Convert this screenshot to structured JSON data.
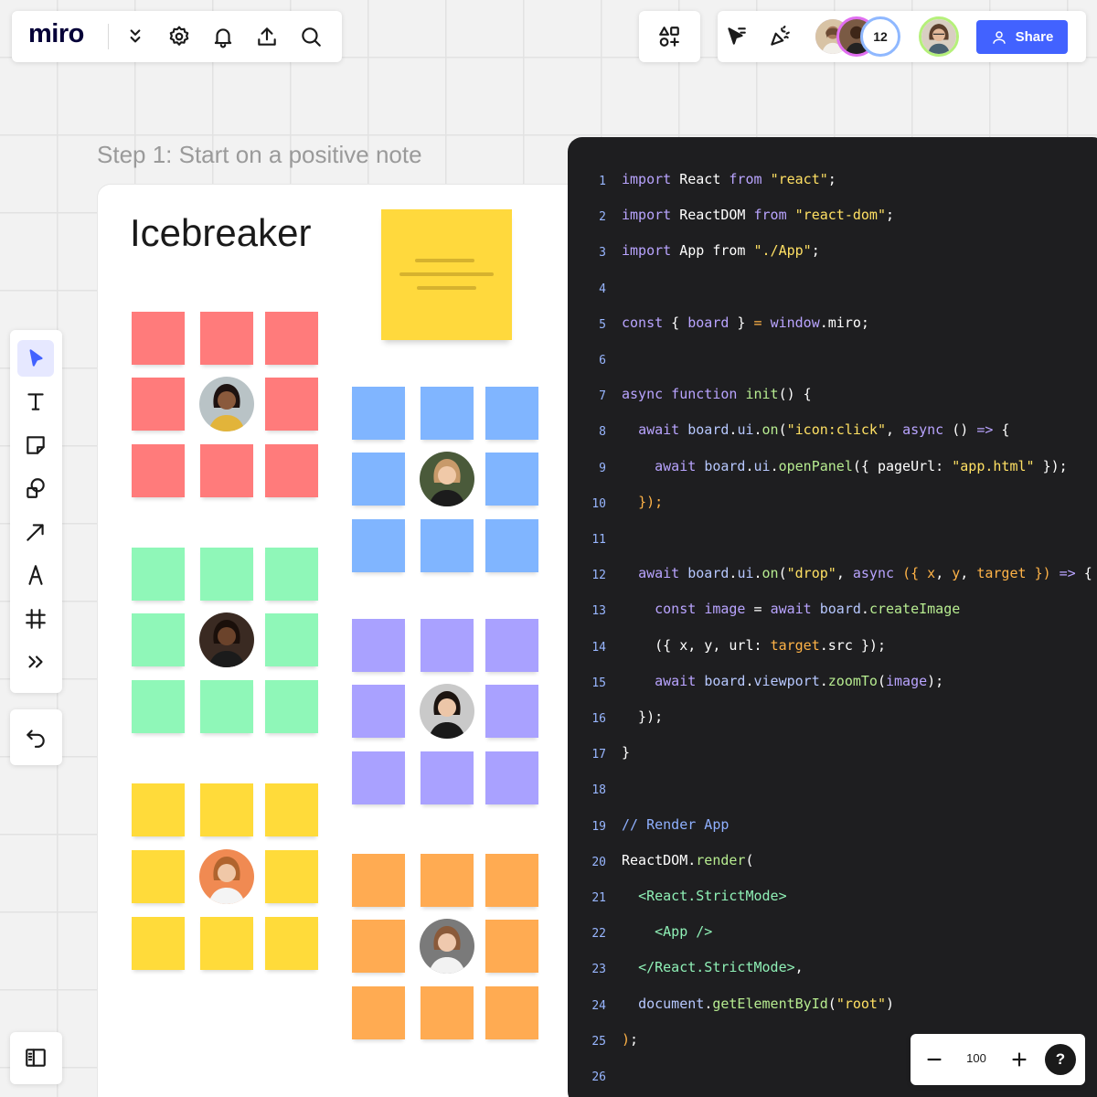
{
  "app": {
    "logo": "miro",
    "participant_count": "12",
    "share_label": "Share"
  },
  "topbar": {
    "icons": [
      "chevron-double-down-icon",
      "gear-icon",
      "bell-icon",
      "upload-icon",
      "search-icon"
    ],
    "apps_icon": "apps-icon",
    "right_icons": [
      "cursor-follow-icon",
      "celebrate-icon"
    ]
  },
  "board": {
    "step_label": "Step 1: Start on a positive note",
    "title": "Icebreaker"
  },
  "colors": {
    "red": "#ff7b7b",
    "green": "#8ff7b8",
    "yellow": "#ffdb3a",
    "blue": "#80b5ff",
    "purple": "#a9a1ff",
    "orange": "#ffab52",
    "accent": "#4262ff",
    "code_bg": "#1e1e20"
  },
  "toolbar": {
    "tools": [
      "select-icon",
      "text-icon",
      "sticky-note-icon",
      "shapes-icon",
      "arrow-icon",
      "pen-icon",
      "frame-icon",
      "more-tools-icon"
    ],
    "undo": "undo-icon",
    "sidebar": "sidebar-toggle-icon"
  },
  "code": {
    "line_numbers": [
      "1",
      "2",
      "3",
      "4",
      "5",
      "6",
      "7",
      "8",
      "9",
      "10",
      "11",
      "12",
      "13",
      "14",
      "15",
      "16",
      "17",
      "18",
      "19",
      "20",
      "21",
      "22",
      "23",
      "24",
      "25",
      "26"
    ],
    "lines": [
      [
        [
          "kw",
          "import"
        ],
        [
          "p",
          " React "
        ],
        [
          "kw",
          "from"
        ],
        [
          "p",
          " "
        ],
        [
          "str",
          "\"react\""
        ],
        [
          "p",
          ";"
        ]
      ],
      [
        [
          "kw",
          "import"
        ],
        [
          "p",
          " ReactDOM "
        ],
        [
          "kw",
          "from"
        ],
        [
          "p",
          " "
        ],
        [
          "str",
          "\"react-dom\""
        ],
        [
          "p",
          ";"
        ]
      ],
      [
        [
          "kw",
          "import"
        ],
        [
          "p",
          " App from "
        ],
        [
          "str",
          "\"./App\""
        ],
        [
          "p",
          ";"
        ]
      ],
      [],
      [
        [
          "kw",
          "const"
        ],
        [
          "p",
          " { "
        ],
        [
          "var",
          "board"
        ],
        [
          "p",
          " } "
        ],
        [
          "punc",
          "="
        ],
        [
          "p",
          " "
        ],
        [
          "var",
          "window"
        ],
        [
          "p",
          ".miro;"
        ]
      ],
      [],
      [
        [
          "kw",
          "async function"
        ],
        [
          "p",
          " "
        ],
        [
          "fn",
          "init"
        ],
        [
          "p",
          "() {"
        ]
      ],
      [
        [
          "p",
          "  "
        ],
        [
          "kw",
          "await"
        ],
        [
          "p",
          " "
        ],
        [
          "obj",
          "board"
        ],
        [
          "p",
          "."
        ],
        [
          "obj",
          "ui"
        ],
        [
          "p",
          "."
        ],
        [
          "fn",
          "on"
        ],
        [
          "p",
          "("
        ],
        [
          "str",
          "\"icon:click\""
        ],
        [
          "p",
          ", "
        ],
        [
          "kw",
          "async"
        ],
        [
          "p",
          " () "
        ],
        [
          "kw",
          "=>"
        ],
        [
          "p",
          " {"
        ]
      ],
      [
        [
          "p",
          "    "
        ],
        [
          "kw",
          "await"
        ],
        [
          "p",
          " "
        ],
        [
          "obj",
          "board"
        ],
        [
          "p",
          "."
        ],
        [
          "obj",
          "ui"
        ],
        [
          "p",
          "."
        ],
        [
          "fn",
          "openPanel"
        ],
        [
          "p",
          "({ pageUrl: "
        ],
        [
          "str",
          "\"app.html\""
        ],
        [
          "p",
          " });"
        ]
      ],
      [
        [
          "p",
          "  "
        ],
        [
          "punc",
          "});"
        ]
      ],
      [],
      [
        [
          "p",
          "  "
        ],
        [
          "kw",
          "await"
        ],
        [
          "p",
          " "
        ],
        [
          "obj",
          "board"
        ],
        [
          "p",
          "."
        ],
        [
          "obj",
          "ui"
        ],
        [
          "p",
          "."
        ],
        [
          "fn",
          "on"
        ],
        [
          "p",
          "("
        ],
        [
          "str",
          "\"drop\""
        ],
        [
          "p",
          ", "
        ],
        [
          "kw",
          "async"
        ],
        [
          "p",
          " "
        ],
        [
          "punc",
          "({"
        ],
        [
          "p",
          " "
        ],
        [
          "prop",
          "x"
        ],
        [
          "p",
          ", "
        ],
        [
          "prop",
          "y"
        ],
        [
          "p",
          ", "
        ],
        [
          "prop",
          "target"
        ],
        [
          "p",
          " "
        ],
        [
          "punc",
          "})"
        ],
        [
          "p",
          " "
        ],
        [
          "kw",
          "=>"
        ],
        [
          "p",
          " {"
        ]
      ],
      [
        [
          "p",
          "    "
        ],
        [
          "kw",
          "const"
        ],
        [
          "p",
          " "
        ],
        [
          "var",
          "image"
        ],
        [
          "p",
          " = "
        ],
        [
          "kw",
          "await"
        ],
        [
          "p",
          " "
        ],
        [
          "obj",
          "board"
        ],
        [
          "p",
          "."
        ],
        [
          "fn",
          "createImage"
        ]
      ],
      [
        [
          "p",
          "    ({ x, y, url: "
        ],
        [
          "prop",
          "target"
        ],
        [
          "p",
          ".src });"
        ]
      ],
      [
        [
          "p",
          "    "
        ],
        [
          "kw",
          "await"
        ],
        [
          "p",
          " "
        ],
        [
          "obj",
          "board"
        ],
        [
          "p",
          "."
        ],
        [
          "obj",
          "viewport"
        ],
        [
          "p",
          "."
        ],
        [
          "fn",
          "zoomTo"
        ],
        [
          "p",
          "("
        ],
        [
          "var",
          "image"
        ],
        [
          "p",
          ");"
        ]
      ],
      [
        [
          "p",
          "  });"
        ]
      ],
      [
        [
          "p",
          "}"
        ]
      ],
      [],
      [
        [
          "cm",
          "// Render App"
        ]
      ],
      [
        [
          "p",
          "ReactDOM."
        ],
        [
          "fn",
          "render"
        ],
        [
          "p",
          "("
        ]
      ],
      [
        [
          "p",
          "  "
        ],
        [
          "jsx",
          "<React.StrictMode>"
        ]
      ],
      [
        [
          "p",
          "    "
        ],
        [
          "jsx",
          "<App />"
        ]
      ],
      [
        [
          "p",
          "  "
        ],
        [
          "jsx",
          "</React.StrictMode>"
        ],
        [
          "p",
          ","
        ]
      ],
      [
        [
          "p",
          "  "
        ],
        [
          "obj",
          "document"
        ],
        [
          "p",
          "."
        ],
        [
          "fn",
          "getElementById"
        ],
        [
          "p",
          "("
        ],
        [
          "str",
          "\"root\""
        ],
        [
          "p",
          ")"
        ]
      ],
      [
        [
          "punc",
          ")"
        ],
        [
          "p",
          ";"
        ]
      ],
      []
    ]
  },
  "zoom": {
    "value": "100",
    "minus_icon": "zoom-out-icon",
    "plus_icon": "zoom-in-icon",
    "help": "?"
  }
}
